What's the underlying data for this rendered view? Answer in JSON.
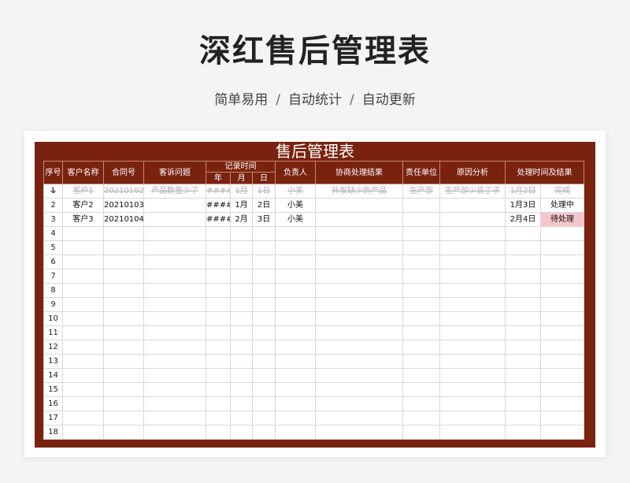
{
  "header": {
    "title": "深红售后管理表",
    "subtitle_parts": [
      "简单易用",
      "自动统计",
      "自动更新"
    ],
    "separator": "/"
  },
  "sheet": {
    "title": "售后管理表",
    "columns": {
      "seq": "序号",
      "customer": "客户名称",
      "contract": "合同号",
      "complaint": "客诉问题",
      "record_time": "记录时间",
      "year": "年",
      "month": "月",
      "day": "日",
      "owner": "负责人",
      "resolution": "协商处理结果",
      "dept": "责任单位",
      "cause": "原因分析",
      "handling": "处理时间及结果"
    },
    "rows": [
      {
        "seq": "1",
        "customer": "客户1",
        "contract": "20210102",
        "complaint": "产品数量少了",
        "year": "#####",
        "month": "1月",
        "day": "1日",
        "owner": "小美",
        "resolution": "补发缺少的产品",
        "dept": "生产部",
        "cause": "生产部少装了子",
        "handle_date": "1月2日",
        "handle_status": "完成",
        "struck": true
      },
      {
        "seq": "2",
        "customer": "客户2",
        "contract": "20210103",
        "complaint": "",
        "year": "#####",
        "month": "1月",
        "day": "2日",
        "owner": "小美",
        "resolution": "",
        "dept": "",
        "cause": "",
        "handle_date": "1月3日",
        "handle_status": "处理中"
      },
      {
        "seq": "3",
        "customer": "客户3",
        "contract": "20210104",
        "complaint": "",
        "year": "#####",
        "month": "2月",
        "day": "3日",
        "owner": "小美",
        "resolution": "",
        "dept": "",
        "cause": "",
        "handle_date": "2月4日",
        "handle_status": "待处理",
        "pending": true
      },
      {
        "seq": "4"
      },
      {
        "seq": "5"
      },
      {
        "seq": "6"
      },
      {
        "seq": "7"
      },
      {
        "seq": "8"
      },
      {
        "seq": "9"
      },
      {
        "seq": "10"
      },
      {
        "seq": "11"
      },
      {
        "seq": "12"
      },
      {
        "seq": "13"
      },
      {
        "seq": "14"
      },
      {
        "seq": "15"
      },
      {
        "seq": "16"
      },
      {
        "seq": "17"
      },
      {
        "seq": "18"
      }
    ]
  },
  "colors": {
    "sheet_bg": "#7a2210",
    "pending_bg": "#f7c6cc",
    "pending_text": "#c0392b"
  }
}
